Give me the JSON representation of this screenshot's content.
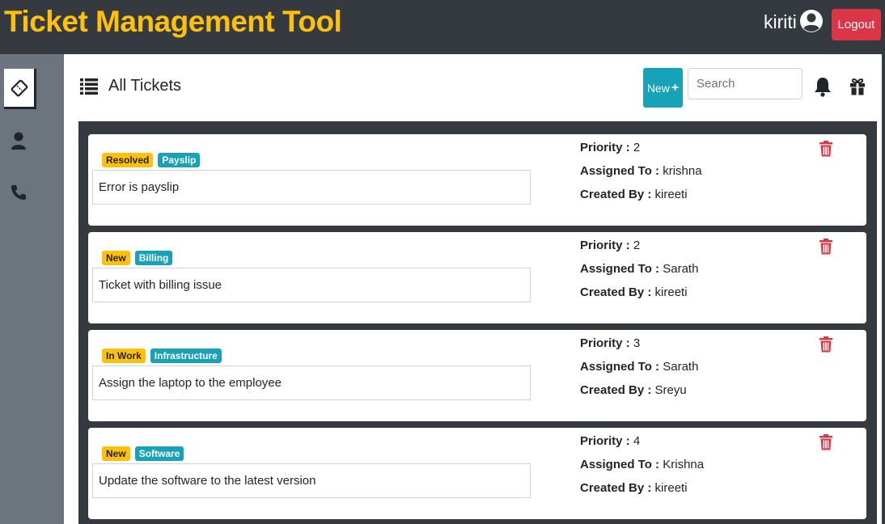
{
  "app": {
    "title": "Ticket Management Tool",
    "user": "kiriti",
    "logout_label": "Logout"
  },
  "sidebar": {
    "items": [
      {
        "name": "tickets",
        "icon": "ticket-icon",
        "active": true
      },
      {
        "name": "users",
        "icon": "user-icon",
        "active": false
      },
      {
        "name": "contact",
        "icon": "phone-icon",
        "active": false
      }
    ]
  },
  "toolbar": {
    "title": "All Tickets",
    "new_label": "New",
    "new_plus": "+",
    "search_placeholder": "Search",
    "icons": [
      "list-icon",
      "bell-icon",
      "gift-icon"
    ]
  },
  "labels": {
    "priority": "Priority :",
    "assigned_to": "Assigned To :",
    "created_by": "Created By :"
  },
  "tickets": [
    {
      "status": "Resolved",
      "category": "Payslip",
      "description": "Error is payslip",
      "priority": "2",
      "assigned_to": "krishna",
      "created_by": "kireeti"
    },
    {
      "status": "New",
      "category": "Billing",
      "description": "Ticket with billing issue",
      "priority": "2",
      "assigned_to": "Sarath",
      "created_by": "kireeti"
    },
    {
      "status": "In Work",
      "category": "Infrastructure",
      "description": "Assign the laptop to the employee",
      "priority": "3",
      "assigned_to": "Sarath",
      "created_by": "Sreyu"
    },
    {
      "status": "New",
      "category": "Software",
      "description": "Update the software to the latest version",
      "priority": "4",
      "assigned_to": "Krishna",
      "created_by": "kireeti"
    }
  ],
  "colors": {
    "navbar": "#343a40",
    "brand": "#ffc107",
    "sidebar": "#6c757d",
    "status_badge": "#ffc107",
    "category_badge": "#17a2b8",
    "new_button": "#17a2b8",
    "danger": "#dc3545"
  }
}
